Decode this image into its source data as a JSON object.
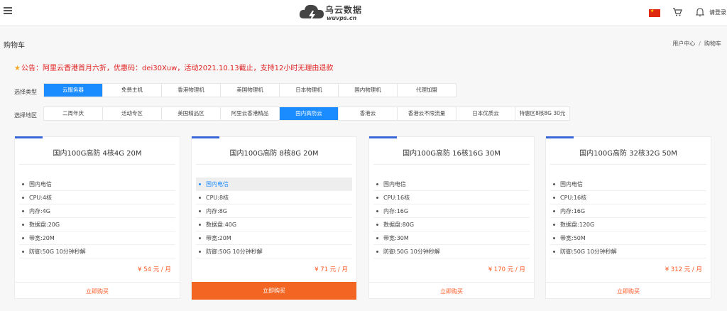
{
  "header": {
    "logo_text": "乌云数据",
    "logo_sub": "wuvps.cn",
    "login_label": "请登录"
  },
  "page": {
    "title": "购物车",
    "breadcrumb": [
      "用户中心",
      "购物车"
    ]
  },
  "notice": {
    "text": "公告：阿里云香港首月六折，优惠码：dei30Xuw，活动2021.10.13截止，支持12小时无理由退款"
  },
  "filters": {
    "type": {
      "label": "选择类型",
      "options": [
        "云服务器",
        "免费主机",
        "香港物理机",
        "美国物理机",
        "日本物理机",
        "国内物理机",
        "代理加盟"
      ],
      "active": 0
    },
    "region": {
      "label": "选择地区",
      "options": [
        "二周年庆",
        "活动专区",
        "美国精品区",
        "阿里云香港精品",
        "国内高防云",
        "香港云",
        "香港云不限流量",
        "日本优质云",
        "特惠区8核8G 30元"
      ],
      "active": 4
    }
  },
  "products": [
    {
      "title": "国内100G高防 4核4G 20M",
      "specs": [
        "国内电信",
        "CPU:4核",
        "内存:4G",
        "数据盘:20G",
        "带宽:20M",
        "防御:50G 10分钟秒解"
      ],
      "price": "¥ 54 元 / 月",
      "buy_label": "立即购买"
    },
    {
      "title": "国内100G高防 8核8G 20M",
      "specs": [
        "国内电信",
        "CPU:8核",
        "内存:8G",
        "数据盘:40G",
        "带宽:20M",
        "防御:50G 10分钟秒解"
      ],
      "price": "¥ 71 元 / 月",
      "buy_label": "立即购买"
    },
    {
      "title": "国内100G高防 16核16G 30M",
      "specs": [
        "国内电信",
        "CPU:16核",
        "内存:16G",
        "数据盘:80G",
        "带宽:30M",
        "防御:50G 10分钟秒解"
      ],
      "price": "¥ 170 元 / 月",
      "buy_label": "立即购买"
    },
    {
      "title": "国内100G高防 32核32G 50M",
      "specs": [
        "国内电信",
        "CPU:16核",
        "内存:16G",
        "数据盘:120G",
        "带宽:50M",
        "防御:50G 10分钟秒解"
      ],
      "price": "¥ 312 元 / 月",
      "buy_label": "立即购买"
    }
  ],
  "colors": {
    "accent_blue": "#1a8cff",
    "buy_orange": "#f26522",
    "price_red": "#ff5722",
    "notice_red": "#e02020"
  }
}
